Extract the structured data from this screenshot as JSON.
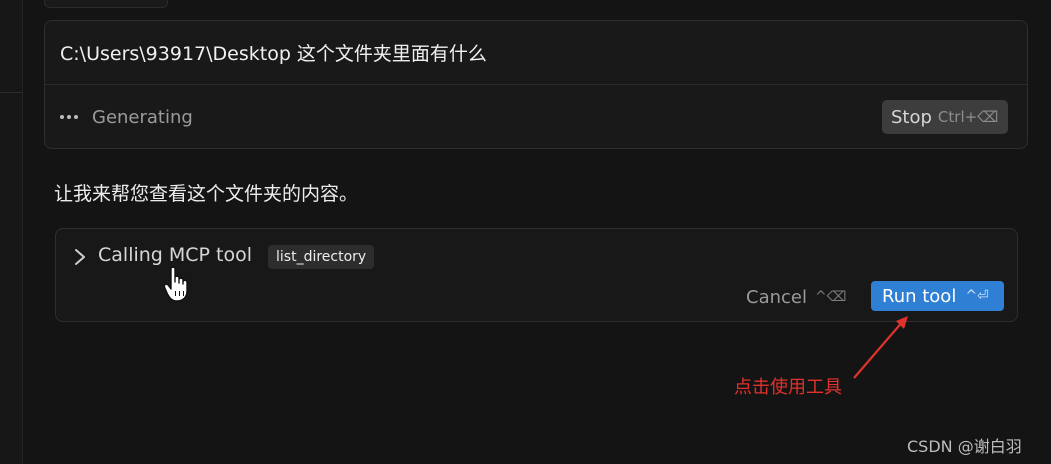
{
  "prompt": {
    "text": "C:\\Users\\93917\\Desktop 这个文件夹里面有什么",
    "status_label": "Generating",
    "stop_label": "Stop",
    "stop_shortcut": "Ctrl+⌫"
  },
  "assistant": {
    "message": "让我来帮您查看这个文件夹的内容。"
  },
  "tool_call": {
    "calling_label": "Calling MCP tool",
    "tool_name": "list_directory",
    "cancel_label": "Cancel",
    "cancel_shortcut": "^⌫",
    "run_label": "Run tool",
    "run_shortcut": "^⏎"
  },
  "annotation": {
    "text": "点击使用工具",
    "color": "#e0322c"
  },
  "watermark": "CSDN @谢白羽",
  "colors": {
    "background": "#151414",
    "run_button": "#2f7fd4",
    "stop_button": "#3e3d3d"
  },
  "icons": [
    "ellipsis-icon",
    "chevron-right-icon",
    "hand-pointer-icon",
    "arrow-icon"
  ]
}
